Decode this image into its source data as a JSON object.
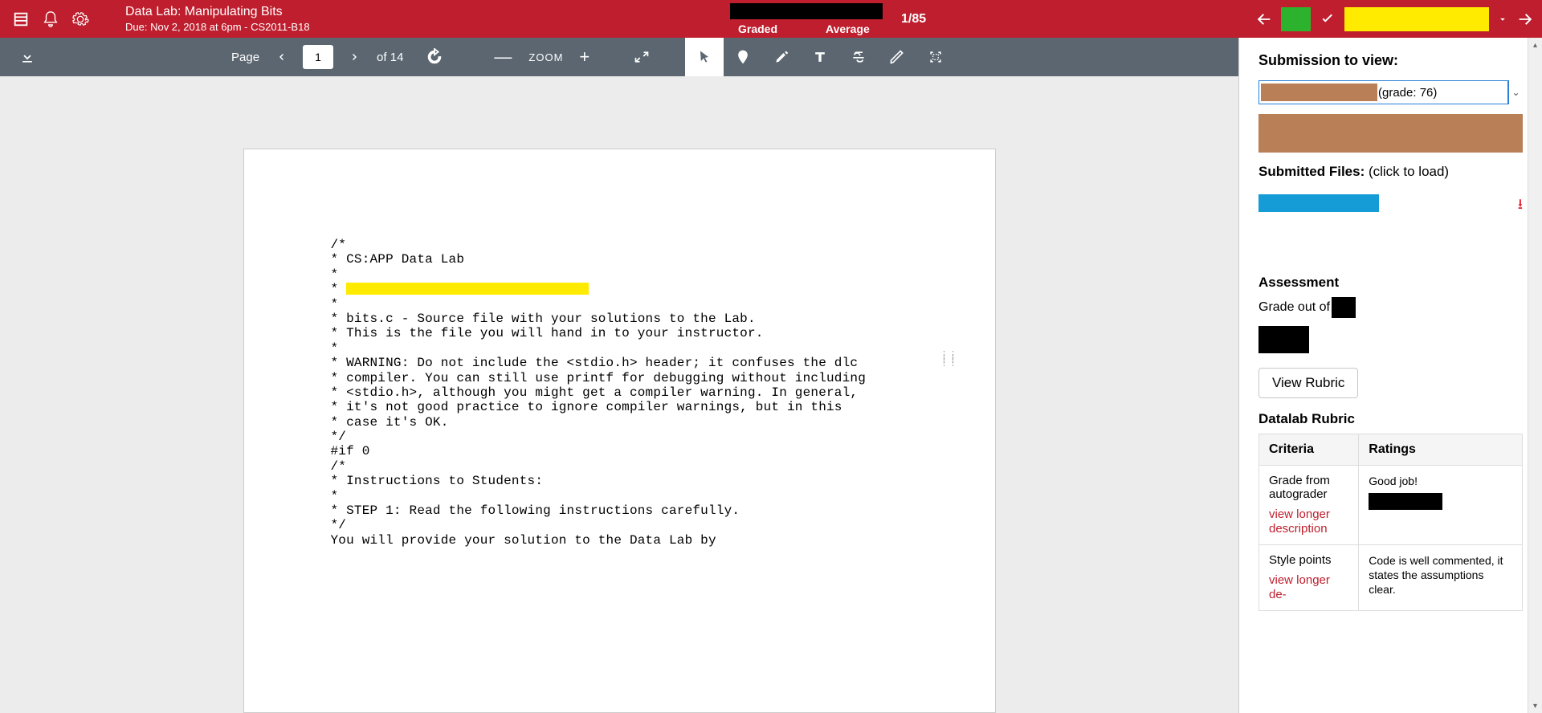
{
  "topbar": {
    "title": "Data Lab: Manipulating Bits",
    "due": "Due: Nov 2, 2018 at 6pm - CS2011-B18",
    "stat_left": "Graded",
    "stat_right": "Average",
    "counter": "1/85"
  },
  "toolbar": {
    "page_label": "Page",
    "page_current": "1",
    "page_of": "of 14",
    "zoom_label": "ZOOM"
  },
  "doc": {
    "l1": "/*",
    "l2": " *   CS:APP Data Lab",
    "l3": " *",
    "l4_prefix": " *   ",
    "l5": " *",
    "l6": " *   bits.c - Source file with your solutions to the Lab.",
    "l7": " *   This is the file you will hand in to your instructor.",
    "l8": " *",
    "l9": " *   WARNING: Do not include the <stdio.h> header; it confuses the dlc",
    "l10": " *   compiler. You can still use printf for debugging without including",
    "l11": " *   <stdio.h>, although you might get a compiler warning. In general,",
    "l12": " *   it's not good practice to ignore compiler warnings, but in this",
    "l13": " *   case it's OK.",
    "l14": " */",
    "l15": "",
    "l16": "#if 0",
    "l17": "/*",
    "l18": " *   Instructions to Students:",
    "l19": " *",
    "l20": " *   STEP 1: Read the following instructions carefully.",
    "l21": " */",
    "l22": "",
    "l23": "You will provide your solution to the Data Lab by"
  },
  "sidebar": {
    "heading": "Submission to view:",
    "grade_suffix": "(grade: 76)",
    "files_label_b": "Submitted Files:",
    "files_label_r": " (click to load)",
    "assess_h": "Assessment",
    "grade_out": "Grade out of",
    "view_rubric": "View Rubric",
    "rubric_title": "Datalab Rubric",
    "th_criteria": "Criteria",
    "th_ratings": "Ratings",
    "r1_criteria": "Grade from autograder",
    "r1_link": "view longer description",
    "r1_rating": "Good job!",
    "r2_criteria": "Style points",
    "r2_link": "view longer de-",
    "r2_rating": "Code is well commented, it states the assumptions clear."
  }
}
